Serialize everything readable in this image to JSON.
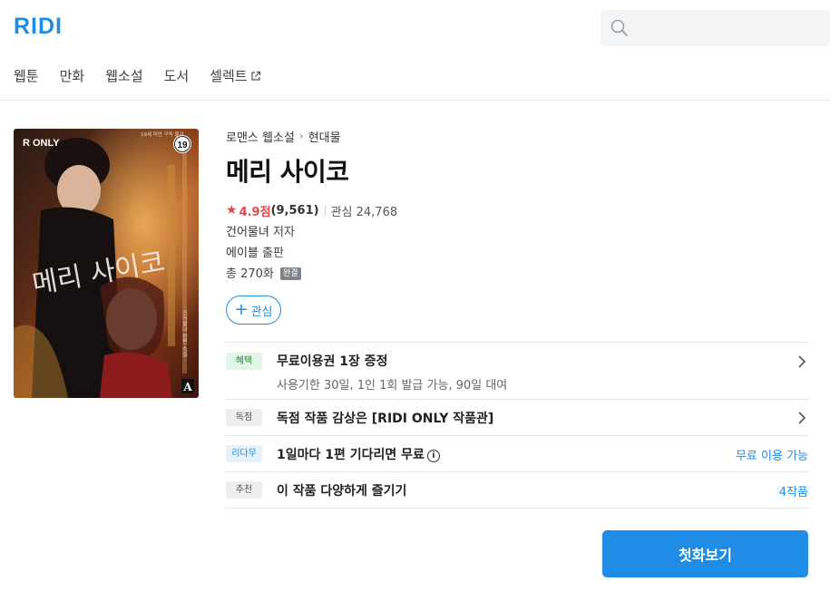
{
  "header": {
    "logo": "RIDI",
    "search_placeholder": "",
    "nav": [
      {
        "label": "웹툰"
      },
      {
        "label": "만화"
      },
      {
        "label": "웹소설"
      },
      {
        "label": "도서"
      },
      {
        "label": "셀렉트"
      }
    ]
  },
  "book": {
    "cover": {
      "badge": "R ONLY",
      "top_text": "19세 미만 구독 불가",
      "age_badge": "19",
      "title_art": "메리 사이코",
      "author_art": "건어물녀 장편 소설",
      "publisher_mark": "A"
    },
    "breadcrumb": [
      "로맨스 웹소설",
      "현대물"
    ],
    "title": "메리 사이코",
    "rating": {
      "score": "4.9점",
      "count": "(9,561)",
      "favorites": "관심 24,768"
    },
    "author": "건어물녀",
    "author_suffix": "저자",
    "publisher": "에이블",
    "publisher_suffix": "출판",
    "episodes": "총 270화",
    "status_badge": "완결",
    "fav_button": "관심"
  },
  "rows": [
    {
      "tag": "혜택",
      "main": "무료이용권 1장 증정",
      "sub": "사용기한 30일, 1인 1회 발급 가능, 90일 대여"
    },
    {
      "tag": "독점",
      "main": "독점 작품 감상은 [RIDI ONLY 작품관]"
    },
    {
      "tag": "리다무",
      "main": "1일마다 1편 기다리면 무료",
      "right": "무료 이용 가능"
    },
    {
      "tag": "추천",
      "main": "이 작품 다양하게 즐기기",
      "right": "4작품"
    }
  ],
  "cta": "첫화보기",
  "colors": {
    "accent": "#1f8ce6",
    "rating": "#e5454b"
  }
}
